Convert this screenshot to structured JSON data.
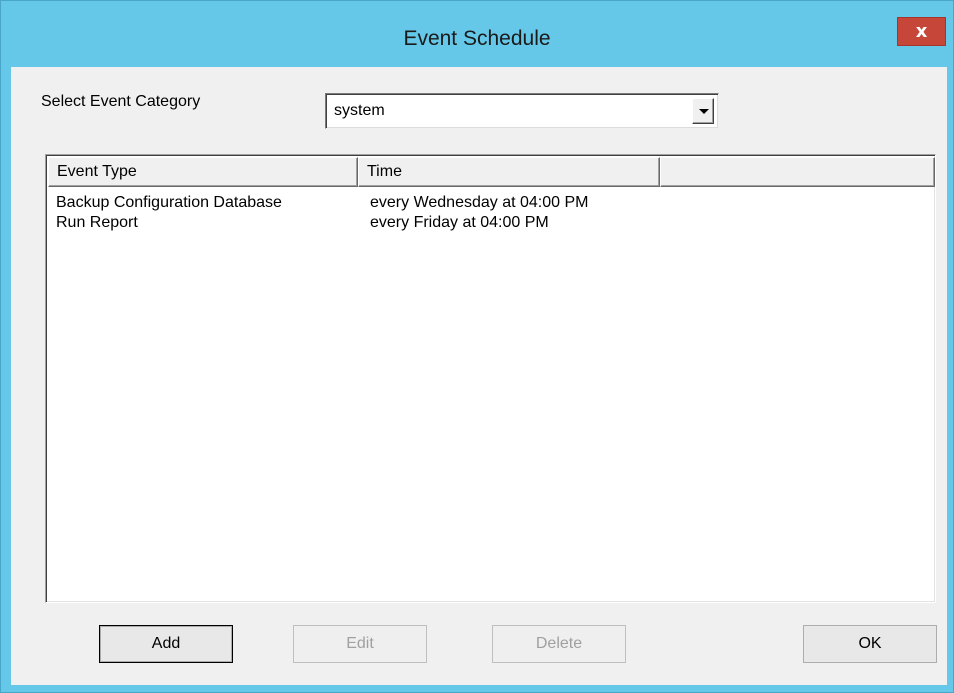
{
  "window": {
    "title": "Event Schedule",
    "close_label": "x"
  },
  "category": {
    "label": "Select Event Category",
    "selected": "system"
  },
  "table": {
    "columns": [
      "Event Type",
      "Time",
      ""
    ],
    "rows": [
      {
        "event_type": "Backup Configuration Database",
        "time": "every Wednesday at 04:00 PM"
      },
      {
        "event_type": "Run Report",
        "time": "every Friday at 04:00 PM"
      }
    ]
  },
  "buttons": {
    "add": "Add",
    "edit": "Edit",
    "delete": "Delete",
    "ok": "OK"
  },
  "colors": {
    "title_bar": "#66c8e8",
    "close_button": "#c7463a",
    "dialog_face": "#f0f0f0"
  }
}
